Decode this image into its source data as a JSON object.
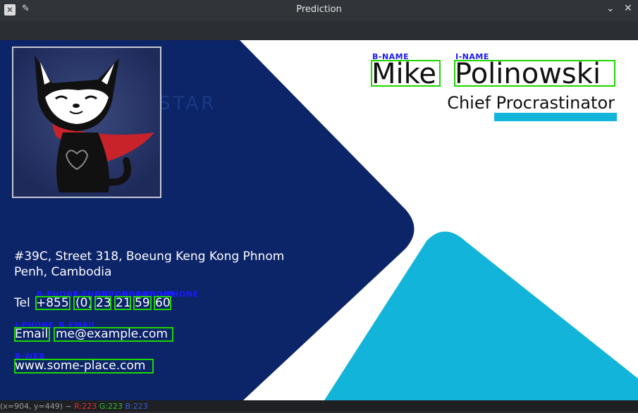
{
  "window": {
    "title": "Prediction",
    "app_icon": "x-app-icon",
    "pin_icon": "pin-icon",
    "minimize_icon": "chevron-down-icon",
    "close_icon": "close-icon"
  },
  "card": {
    "first_name": "Mike",
    "last_name": "Polinowski",
    "job_title": "Chief Procrastinator",
    "address_line1": "#39C, Street 318, Boeung Keng Kong Phnom",
    "address_line2": "Penh, Cambodia",
    "tel_label": "Tel",
    "phone_parts": [
      "+855",
      "(0)",
      "23",
      "21",
      "59",
      "60"
    ],
    "email_label": "Email",
    "email": "me@example.com",
    "web": "www.some-place.com",
    "watermark": "INSTAR"
  },
  "annotations": {
    "b_name": "B-NAME",
    "i_name": "I-NAME",
    "b_phone": "B-PHONE",
    "i_phone": "I-PHONE",
    "b_email": "B-EMAIL",
    "b_web": "B-WEB",
    "box_color": "#1fd600",
    "label_color": "#1a1aff"
  },
  "colors": {
    "navy": "#0c2468",
    "cyan": "#12b5d9"
  },
  "status": {
    "coords": "(x=904, y=449) ~",
    "r": "R:223",
    "g": "G:223",
    "b": "B:223"
  }
}
